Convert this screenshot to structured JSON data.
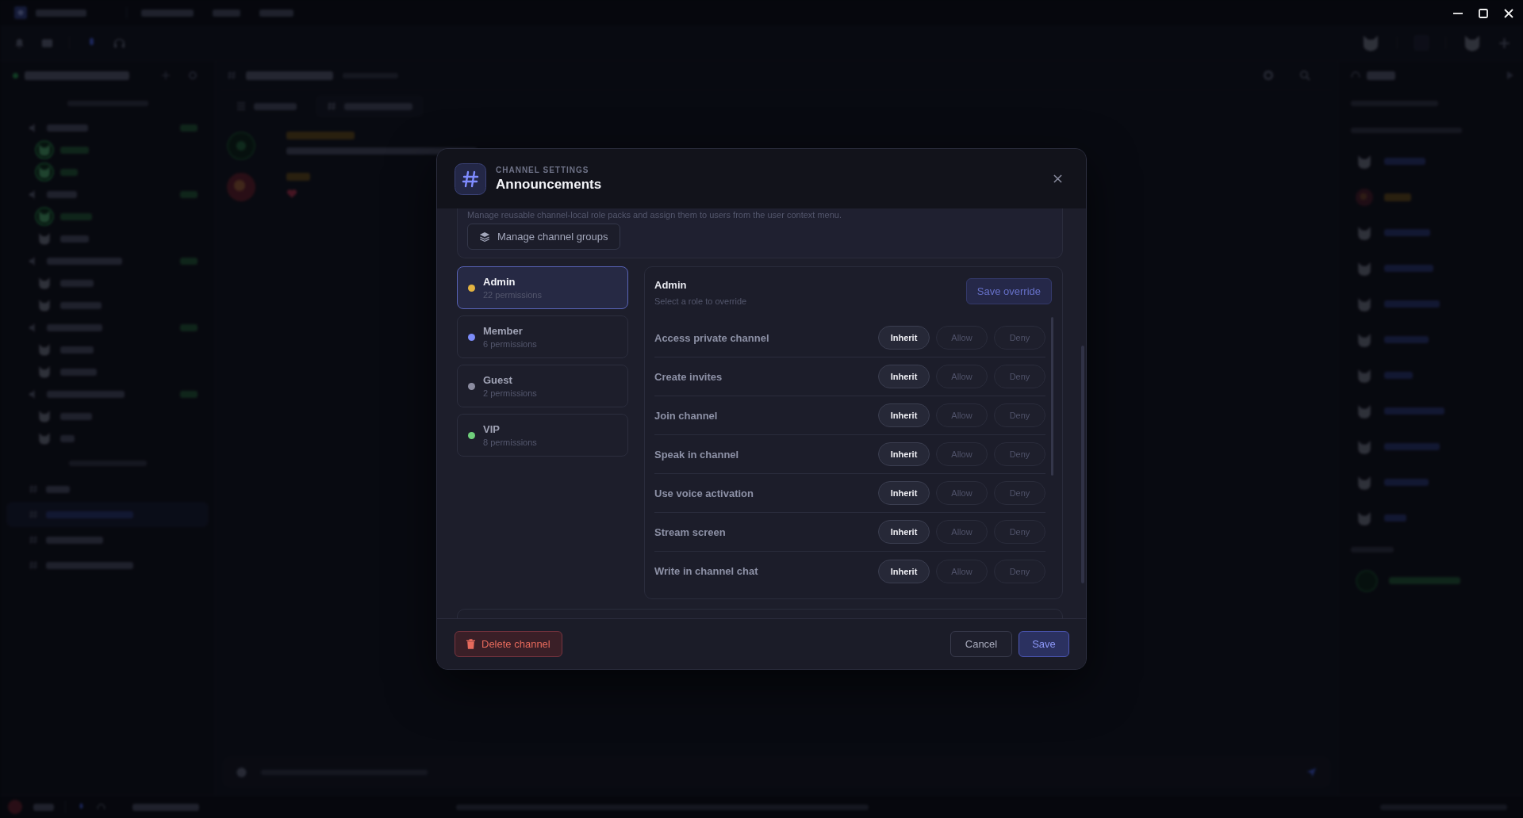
{
  "modal": {
    "eyebrow": "CHANNEL SETTINGS",
    "title": "Announcements",
    "groups": {
      "description": "Manage reusable channel-local role packs and assign them to users from the user context menu.",
      "button": "Manage channel groups"
    },
    "roles": [
      {
        "name": "Admin",
        "count": "22 permissions",
        "color": "#e3b341",
        "selected": true
      },
      {
        "name": "Member",
        "count": "6 permissions",
        "color": "#7c8cf8",
        "selected": false
      },
      {
        "name": "Guest",
        "count": "2 permissions",
        "color": "#8b8ca0",
        "selected": false
      },
      {
        "name": "VIP",
        "count": "8 permissions",
        "color": "#6fcf7b",
        "selected": false
      }
    ],
    "override": {
      "title": "Admin",
      "hint": "Select a role to override",
      "save": {
        "label": "Save override",
        "disabled": true
      },
      "permissions": [
        {
          "label": "Access private channel",
          "options": [
            {
              "label": "Inherit",
              "selected": true
            },
            {
              "label": "Allow",
              "selected": false
            },
            {
              "label": "Deny",
              "selected": false
            }
          ]
        },
        {
          "label": "Create invites",
          "options": [
            {
              "label": "Inherit",
              "selected": true
            },
            {
              "label": "Allow",
              "selected": false
            },
            {
              "label": "Deny",
              "selected": false
            }
          ]
        },
        {
          "label": "Join channel",
          "options": [
            {
              "label": "Inherit",
              "selected": true
            },
            {
              "label": "Allow",
              "selected": false
            },
            {
              "label": "Deny",
              "selected": false
            }
          ]
        },
        {
          "label": "Speak in channel",
          "options": [
            {
              "label": "Inherit",
              "selected": true
            },
            {
              "label": "Allow",
              "selected": false
            },
            {
              "label": "Deny",
              "selected": false
            }
          ]
        },
        {
          "label": "Use voice activation",
          "options": [
            {
              "label": "Inherit",
              "selected": true
            },
            {
              "label": "Allow",
              "selected": false
            },
            {
              "label": "Deny",
              "selected": false
            }
          ]
        },
        {
          "label": "Stream screen",
          "options": [
            {
              "label": "Inherit",
              "selected": true
            },
            {
              "label": "Allow",
              "selected": false
            },
            {
              "label": "Deny",
              "selected": false
            }
          ]
        },
        {
          "label": "Write in channel chat",
          "options": [
            {
              "label": "Inherit",
              "selected": true
            },
            {
              "label": "Allow",
              "selected": false
            },
            {
              "label": "Deny",
              "selected": false
            }
          ]
        }
      ]
    },
    "footer": {
      "delete": "Delete channel",
      "cancel": "Cancel",
      "save": "Save"
    }
  }
}
